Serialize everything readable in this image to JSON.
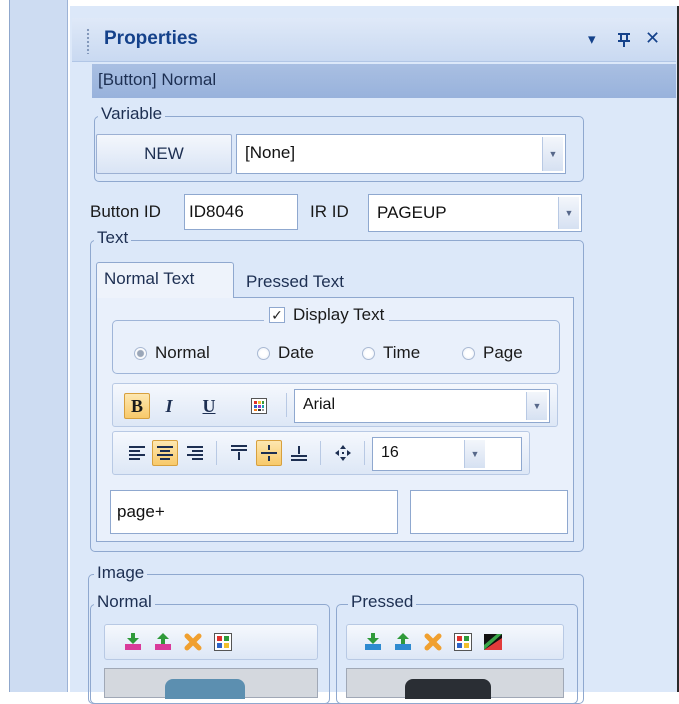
{
  "panel": {
    "title": "Properties",
    "buttons": {
      "dropdown": "▾",
      "pin": "ꟷ",
      "close": "✕"
    },
    "selection": "[Button] Normal"
  },
  "variable": {
    "legend": "Variable",
    "new_label": "NEW",
    "combo_value": "[None]"
  },
  "ids": {
    "button_id_label": "Button ID",
    "button_id_value": "ID8046",
    "ir_id_label": "IR ID",
    "ir_id_value": "PAGEUP"
  },
  "text": {
    "legend": "Text",
    "tabs": [
      "Normal Text",
      "Pressed Text"
    ],
    "display_text_label": "Display Text",
    "display_text_checked": "✓",
    "radios": [
      "Normal",
      "Date",
      "Time",
      "Page"
    ],
    "format_buttons": [
      "B",
      "I",
      "U"
    ],
    "font": "Arial",
    "size": "16",
    "text_value": "page+"
  },
  "image": {
    "legend": "Image",
    "normal_legend": "Normal",
    "pressed_legend": "Pressed"
  },
  "colors": {
    "accent": "#15428b",
    "selection": "#9fb8df",
    "panel_bg": "#dce8f9"
  },
  "icons": {
    "import": "import-icon",
    "export": "export-icon",
    "delete": "delete-icon",
    "palette": "palette-icon",
    "fill": "fill-icon"
  }
}
